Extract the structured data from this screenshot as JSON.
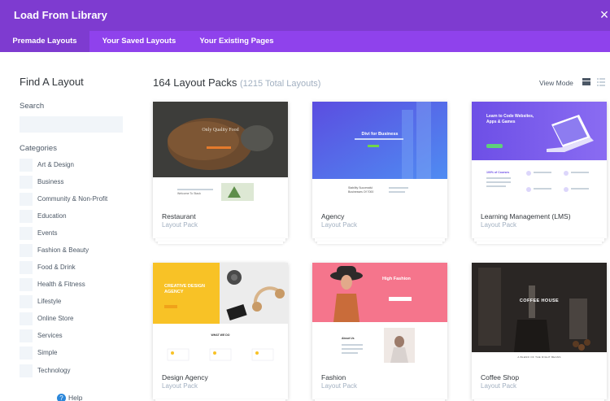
{
  "window": {
    "title": "Load From Library",
    "close": "×"
  },
  "tabs": [
    {
      "label": "Premade Layouts",
      "active": true
    },
    {
      "label": "Your Saved Layouts",
      "active": false
    },
    {
      "label": "Your Existing Pages",
      "active": false
    }
  ],
  "sidebar": {
    "title": "Find A Layout",
    "search_label": "Search",
    "search_placeholder": "",
    "categories_label": "Categories",
    "categories": [
      "Art & Design",
      "Business",
      "Community & Non-Profit",
      "Education",
      "Events",
      "Fashion & Beauty",
      "Food & Drink",
      "Health & Fitness",
      "Lifestyle",
      "Online Store",
      "Services",
      "Simple",
      "Technology"
    ],
    "help": "Help"
  },
  "main": {
    "heading": "164 Layout Packs",
    "subheading": "(1215 Total Layouts)",
    "view_mode": "View Mode",
    "cards": [
      {
        "name": "Restaurant",
        "type": "Layout Pack",
        "preview": {
          "hero": "Only Quality Food",
          "footer": "Welcome To Stack"
        }
      },
      {
        "name": "Agency",
        "type": "Layout Pack",
        "preview": {
          "hero": "Divi for Business",
          "footer": "Stability Successful Businesses Of 7000"
        }
      },
      {
        "name": "Learning Management (LMS)",
        "type": "Layout Pack",
        "preview": {
          "hero": "Learn to Code Websites, Apps & Games",
          "footer": "100% of Courses"
        }
      },
      {
        "name": "Design Agency",
        "type": "Layout Pack",
        "preview": {
          "hero": "CREATIVE DESIGN AGENCY",
          "footer": "WHAT WE DO"
        }
      },
      {
        "name": "Fashion",
        "type": "Layout Pack",
        "preview": {
          "hero": "High Fashion",
          "footer": "About Us"
        }
      },
      {
        "name": "Coffee Shop",
        "type": "Layout Pack",
        "preview": {
          "hero": "COFFEE HOUSE",
          "footer": "A BLEND OF THE RIGHT BEANS"
        }
      }
    ]
  },
  "colors": {
    "titlebar": "#7e3bd0",
    "tabbar": "#8f42ec",
    "muted": "#a2b0c1",
    "text": "#32373c"
  }
}
